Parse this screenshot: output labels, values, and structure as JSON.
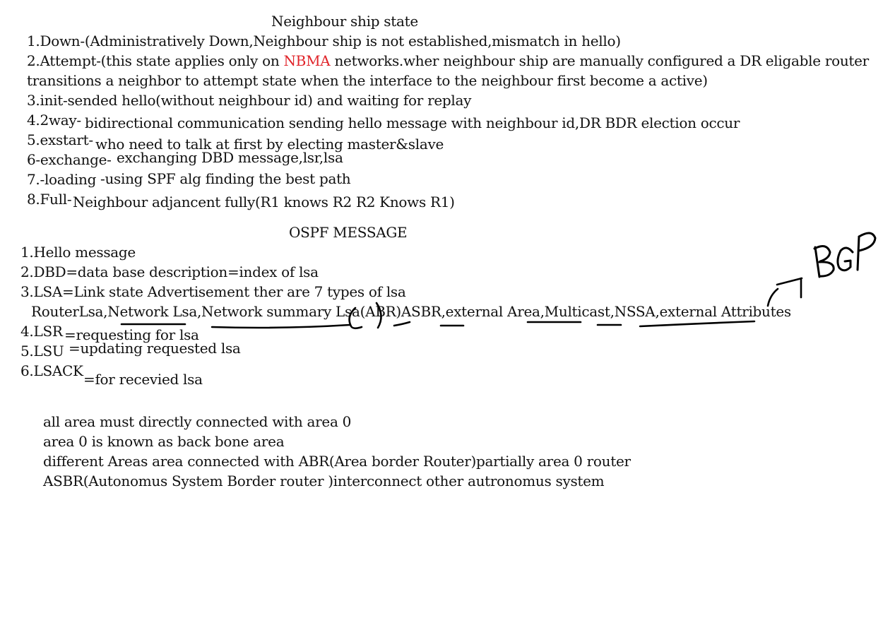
{
  "neighbour_section": {
    "title": "Neighbour ship state",
    "down": "1.Down-(Administratively Down,Neighbour ship is not established,mismatch in hello)",
    "attempt_pre": "2.Attempt-(this state applies only on ",
    "attempt_highlight": "NBMA",
    "attempt_post": " networks.wher neighbour ship are manually configured a DR eligable router",
    "attempt_cont": "transitions a neighbor to attempt state when the interface to the neighbour first become a active)",
    "init": "3.init-sended hello(without neighbour id) and waiting for replay",
    "twoway_label": "4.2way-",
    "twoway_text": "bidirectional communication sending hello message with neighbour id,DR BDR election occur",
    "exstart_label": "5.exstart-",
    "exstart_text": "who need to talk at first by electing master&slave",
    "exchange_label": "6-exchange-",
    "exchange_text": "exchanging DBD message,lsr,lsa",
    "loading_label": "7.-loading",
    "loading_text": "-using SPF alg finding the best path",
    "full_label": "8.Full-",
    "full_text": "Neighbour adjancent fully(R1 knows R2 R2 Knows R1)"
  },
  "ospf_section": {
    "title": "OSPF MESSAGE",
    "hello": "1.Hello message",
    "dbd": "2.DBD=data base description=index of lsa",
    "lsa": "3.LSA=Link state Advertisement ther are 7 types of lsa",
    "lsa_types": "RouterLsa,Network Lsa,Network summary Lsa(ABR)ASBR,external Area,Multicast,NSSA,external Attributes",
    "lsr_label": "4.LSR",
    "lsr_text": "=requesting for lsa",
    "lsu_label": "5.LSU",
    "lsu_text": "=updating requested lsa",
    "lsack_label": "6.LSACK",
    "lsack_text": "=for recevied lsa"
  },
  "area_notes": [
    "all area must directly connected with area 0",
    "area 0 is known as back bone area",
    "different Areas area connected with ABR(Area border Router)partially area 0 router",
    "ASBR(Autonomus System Border router )interconnect other autronomus system"
  ],
  "handwritten_annotation": "BGP",
  "colors": {
    "text": "#111111",
    "highlight": "#e0242a",
    "background": "#ffffff"
  }
}
